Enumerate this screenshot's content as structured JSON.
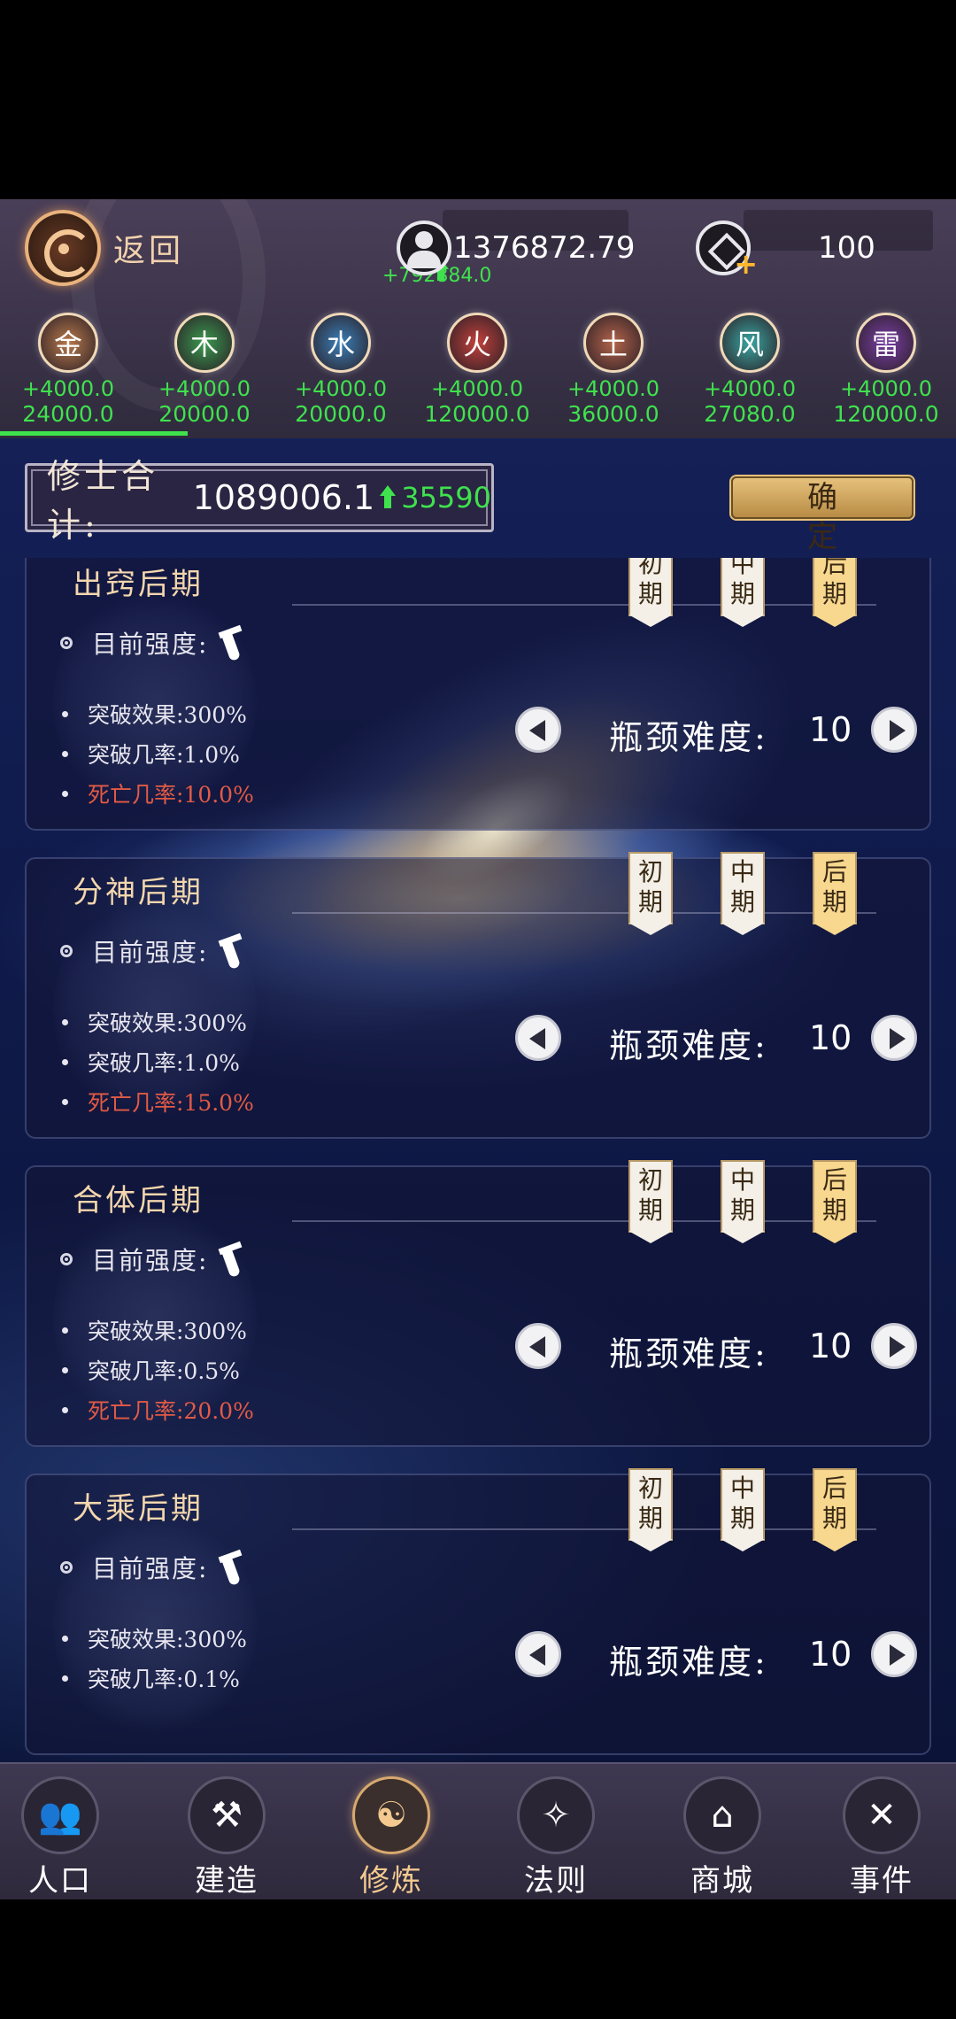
{
  "header": {
    "back_label": "返回",
    "population": {
      "value": "1376872.79",
      "delta": "+792884.0"
    },
    "coins": {
      "value": "100"
    },
    "elements": [
      {
        "name": "金",
        "rate": "+4000.0",
        "total": "24000.0",
        "color": "#b97a4b"
      },
      {
        "name": "木",
        "rate": "+4000.0",
        "total": "20000.0",
        "color": "#3a9a4f"
      },
      {
        "name": "水",
        "rate": "+4000.0",
        "total": "20000.0",
        "color": "#3a7fb8"
      },
      {
        "name": "火",
        "rate": "+4000.0",
        "total": "120000.0",
        "color": "#c2413c"
      },
      {
        "name": "土",
        "rate": "+4000.0",
        "total": "36000.0",
        "color": "#b4644a"
      },
      {
        "name": "风",
        "rate": "+4000.0",
        "total": "27080.0",
        "color": "#3aa6a2"
      },
      {
        "name": "雷",
        "rate": "+4000.0",
        "total": "120000.0",
        "color": "#7b3fa8"
      }
    ]
  },
  "summary": {
    "label": "修士合计:",
    "value": "1089006.1",
    "delta": "35590",
    "confirm_label": "确定"
  },
  "realms": [
    {
      "title": "出窍后期",
      "strength_label": "目前强度:",
      "effect": "突破效果:300%",
      "chance": "突破几率:1.0%",
      "death": "死亡几率:10.0%",
      "difficulty_label": "瓶颈难度:",
      "difficulty": "10",
      "stages": [
        "初期",
        "中期",
        "后期"
      ],
      "active_stage": 2
    },
    {
      "title": "分神后期",
      "strength_label": "目前强度:",
      "effect": "突破效果:300%",
      "chance": "突破几率:1.0%",
      "death": "死亡几率:15.0%",
      "difficulty_label": "瓶颈难度:",
      "difficulty": "10",
      "stages": [
        "初期",
        "中期",
        "后期"
      ],
      "active_stage": 2
    },
    {
      "title": "合体后期",
      "strength_label": "目前强度:",
      "effect": "突破效果:300%",
      "chance": "突破几率:0.5%",
      "death": "死亡几率:20.0%",
      "difficulty_label": "瓶颈难度:",
      "difficulty": "10",
      "stages": [
        "初期",
        "中期",
        "后期"
      ],
      "active_stage": 2
    },
    {
      "title": "大乘后期",
      "strength_label": "目前强度:",
      "effect": "突破效果:300%",
      "chance": "突破几率:0.1%",
      "death": "",
      "difficulty_label": "瓶颈难度:",
      "difficulty": "10",
      "stages": [
        "初期",
        "中期",
        "后期"
      ],
      "active_stage": 2
    }
  ],
  "nav": [
    {
      "label": "人口",
      "icon": "people-icon",
      "glyph": "👥"
    },
    {
      "label": "建造",
      "icon": "tools-icon",
      "glyph": "⚒"
    },
    {
      "label": "修炼",
      "icon": "meditation-icon",
      "glyph": "☯"
    },
    {
      "label": "法则",
      "icon": "scroll-icon",
      "glyph": "✧"
    },
    {
      "label": "商城",
      "icon": "shop-icon",
      "glyph": "⌂"
    },
    {
      "label": "事件",
      "icon": "book-icon",
      "glyph": "✕"
    }
  ],
  "nav_active": 2
}
